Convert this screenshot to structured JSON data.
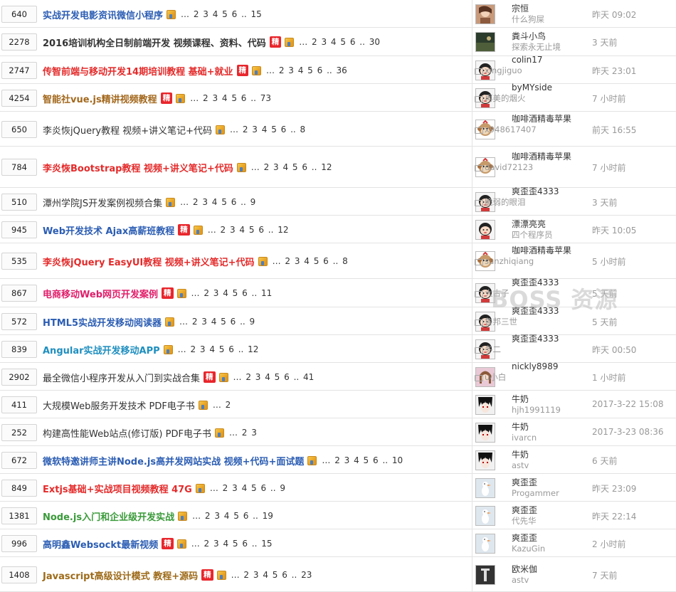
{
  "watermark": "BOSS 资源",
  "badge_label": "精",
  "colors": {
    "blue": "#2b5db3",
    "red": "#e42b2b",
    "orange": "#a3681d",
    "pink": "#e01e6a",
    "green": "#3a9a3a",
    "teal": "#1f8fbf",
    "darkbrown": "#9d6a18",
    "black": "#333333"
  },
  "rows": [
    {
      "count": "640",
      "title": "实战开发电影资讯微信小程序",
      "color": "blue",
      "bold": true,
      "badge": false,
      "pages": "… 2 3 4 5 6 .. 15",
      "user": "宗恒",
      "last": "什么狗屎",
      "time": "昨天 09:02",
      "avatar": "photo"
    },
    {
      "count": "2278",
      "title": "2016培训机构全日制前端开发 视频课程、资料、代码",
      "color": "black",
      "bold": true,
      "badge": true,
      "pages": "… 2 3 4 5 6 .. 30",
      "user": "粪斗小鸟",
      "last": "探索永无止境",
      "time": "3 天前",
      "avatar": "dark"
    },
    {
      "count": "2747",
      "title": "传智前端与移动开发14期培训教程 基础+就业",
      "color": "red",
      "bold": true,
      "badge": true,
      "pages": "… 2 3 4 5 6 .. 36",
      "user": "colin17",
      "last": "xingjiguo",
      "time": "昨天 23:01",
      "avatar": "cartoon"
    },
    {
      "count": "4254",
      "title": "智能社vue.js精讲视频教程",
      "color": "orange",
      "bold": true,
      "badge": true,
      "pages": "… 2 3 4 5 6 .. 73",
      "user": "byMYside",
      "last": "再美的烟火",
      "time": "7 小时前",
      "avatar": "cartoon"
    },
    {
      "count": "650",
      "title": "李炎恢jQuery教程 视频+讲义笔记+代码",
      "color": "black",
      "bold": false,
      "badge": false,
      "pages": "… 2 3 4 5 6 .. 8",
      "user": "咖啡酒精毒苹果",
      "last": "x948617407",
      "time": "前天 16:55",
      "avatar": "monkey"
    },
    {
      "count": "784",
      "title": "李炎恢Bootstrap教程 视频+讲义笔记+代码",
      "color": "red",
      "bold": true,
      "badge": false,
      "pages": "… 2 3 4 5 6 .. 12",
      "user": "咖啡酒精毒苹果",
      "last": "david72123",
      "time": "7 小时前",
      "avatar": "monkey"
    },
    {
      "count": "510",
      "title": "潭州学院JS开发案例视频合集",
      "color": "black",
      "bold": false,
      "badge": false,
      "pages": "… 2 3 4 5 6 .. 9",
      "user": "爽歪歪4333",
      "last": "脆弱的眼泪",
      "time": "3 天前",
      "avatar": "cartoon"
    },
    {
      "count": "945",
      "title": "Web开发技术 Ajax高薪班教程",
      "color": "blue",
      "bold": true,
      "badge": true,
      "pages": "… 2 3 4 5 6 .. 12",
      "user": "漂漂亮亮",
      "last": "四个程序员",
      "time": "昨天 10:05",
      "avatar": "cartoon"
    },
    {
      "count": "535",
      "title": "李炎恢jQuery EasyUI教程 视频+讲义笔记+代码",
      "color": "red",
      "bold": true,
      "badge": false,
      "pages": "… 2 3 4 5 6 .. 8",
      "user": "咖啡酒精毒苹果",
      "last": "sunzhiqiang",
      "time": "5 小时前",
      "avatar": "monkey"
    },
    {
      "count": "867",
      "title": "电商移动Web网页开发案例",
      "color": "pink",
      "bold": true,
      "badge": true,
      "pages": "… 2 3 4 5 6 .. 11",
      "user": "爽歪歪4333",
      "last": "大古子",
      "time": "5 天前",
      "avatar": "cartoon"
    },
    {
      "count": "572",
      "title": "HTML5实战开发移动阅读器",
      "color": "blue",
      "bold": true,
      "badge": false,
      "pages": "… 2 3 4 5 6 .. 9",
      "user": "爽歪歪4333",
      "last": "鲁邦三世",
      "time": "5 天前",
      "avatar": "cartoon"
    },
    {
      "count": "839",
      "title": "Angular实战开发移动APP",
      "color": "teal",
      "bold": true,
      "badge": false,
      "pages": "… 2 3 4 5 6 .. 12",
      "user": "爽歪歪4333",
      "last": "冬二",
      "time": "昨天 00:50",
      "avatar": "cartoon"
    },
    {
      "count": "2902",
      "title": "最全微信小程序开发从入门到实战合集",
      "color": "black",
      "bold": false,
      "badge": true,
      "pages": "… 2 3 4 5 6 .. 41",
      "user": "nickly8989",
      "last": "u小白",
      "time": "1 小时前",
      "avatar": "girl"
    },
    {
      "count": "411",
      "title": "大规模Web服务开发技术 PDF电子书",
      "color": "black",
      "bold": false,
      "badge": false,
      "pages": "… 2",
      "user": "牛奶",
      "last": "hjh1991119",
      "time": "2017-3-22 15:08",
      "avatar": "anime"
    },
    {
      "count": "252",
      "title": "构建高性能Web站点(修订版) PDF电子书",
      "color": "black",
      "bold": false,
      "badge": false,
      "pages": "… 2 3",
      "user": "牛奶",
      "last": "ivarcn",
      "time": "2017-3-23 08:36",
      "avatar": "anime"
    },
    {
      "count": "672",
      "title": "微软特邀讲师主讲Node.js高并发网站实战 视频+代码+面试题",
      "color": "blue",
      "bold": true,
      "badge": false,
      "pages": "… 2 3 4 5 6 .. 10",
      "user": "牛奶",
      "last": "astv",
      "time": "6 天前",
      "avatar": "anime"
    },
    {
      "count": "849",
      "title": "Extjs基础+实战项目视频教程 47G",
      "color": "red",
      "bold": true,
      "badge": false,
      "pages": "… 2 3 4 5 6 .. 9",
      "user": "爽歪歪",
      "last": "Progammer",
      "time": "昨天 23:09",
      "avatar": "bird"
    },
    {
      "count": "1381",
      "title": "Node.js入门和企业级开发实战",
      "color": "green",
      "bold": true,
      "badge": false,
      "pages": "… 2 3 4 5 6 .. 19",
      "user": "爽歪歪",
      "last": "代先华",
      "time": "昨天 22:14",
      "avatar": "bird"
    },
    {
      "count": "996",
      "title": "高明鑫Websockt最新视频",
      "color": "blue",
      "bold": true,
      "badge": true,
      "pages": "… 2 3 4 5 6 .. 15",
      "user": "爽歪歪",
      "last": "KazuGin",
      "time": "2 小时前",
      "avatar": "bird"
    },
    {
      "count": "1408",
      "title": "Javascript高级设计模式 教程+源码",
      "color": "darkbrown",
      "bold": true,
      "badge": true,
      "pages": "… 2 3 4 5 6 .. 23",
      "user": "欧米伽",
      "last": "astv",
      "time": "7 天前",
      "avatar": "dark2"
    }
  ]
}
